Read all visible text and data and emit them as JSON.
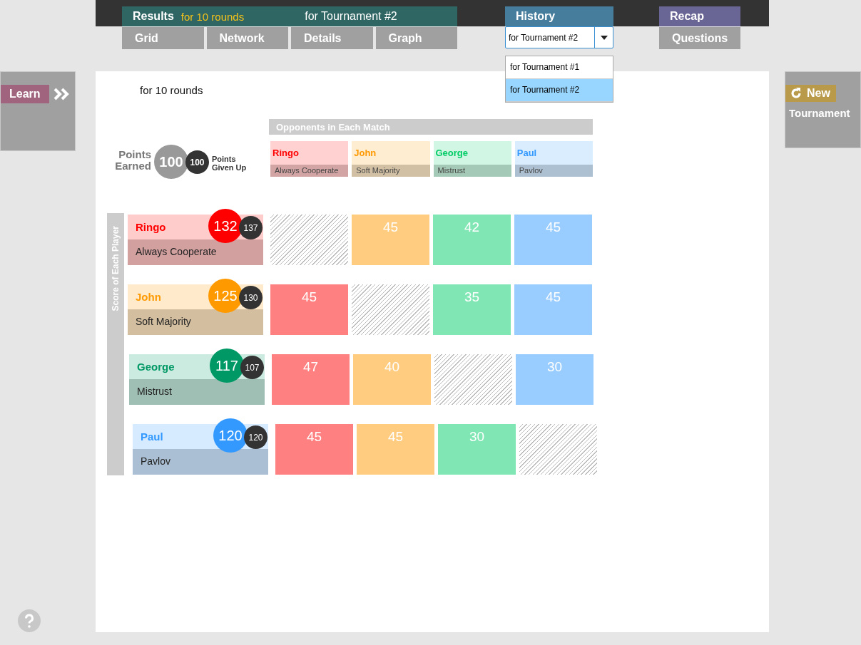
{
  "tab_groups": [
    {
      "label": "Results",
      "subtitle": "for 10 rounds",
      "caption": "for Tournament #2",
      "color": "#2f6663",
      "subtabs": [
        {
          "label": "Grid",
          "selected": false
        },
        {
          "label": "Network",
          "selected": false
        },
        {
          "label": "Details",
          "selected": false
        },
        {
          "label": "Graph",
          "selected": false
        }
      ]
    },
    {
      "label": "History",
      "color": "#467d9c",
      "dropdown": {
        "value": "for Tournament #2",
        "expanded": true,
        "options": [
          {
            "label": "for Tournament #1",
            "selected": false
          },
          {
            "label": "for Tournament #2",
            "selected": true
          }
        ]
      }
    },
    {
      "label": "Recap",
      "color": "#696594",
      "subtabs": [
        {
          "label": "Questions",
          "selected": false
        }
      ]
    }
  ],
  "learn_panel": {
    "label": "Learn"
  },
  "new_panel": {
    "label": "New",
    "sublabel": "Tournament"
  },
  "heading": "for 10 rounds",
  "legend": {
    "earned_label": "Points Earned",
    "earned_value": "100",
    "given_value": "100",
    "given_label": "Points Given Up"
  },
  "opponents_title": "Opponents in Each Match",
  "row_axis_title": "Score of Each Player",
  "opponents": [
    {
      "name": "Ringo",
      "strategy": "Always Cooperate",
      "color": "#ff0000"
    },
    {
      "name": "John",
      "strategy": "Soft Majority",
      "color": "#ff9900"
    },
    {
      "name": "George",
      "strategy": "Mistrust",
      "color": "#00cc66"
    },
    {
      "name": "Paul",
      "strategy": "Pavlov",
      "color": "#3399ff"
    }
  ],
  "players": [
    {
      "name": "Ringo",
      "strategy": "Always Cooperate",
      "color": "#ff0000",
      "score": "132",
      "given_up": "137",
      "cells": [
        {
          "kind": "self"
        },
        {
          "kind": "score",
          "value": "45"
        },
        {
          "kind": "score",
          "value": "42"
        },
        {
          "kind": "score",
          "value": "45"
        }
      ]
    },
    {
      "name": "John",
      "strategy": "Soft Majority",
      "color": "#ff9900",
      "score": "125",
      "given_up": "130",
      "cells": [
        {
          "kind": "score",
          "value": "45"
        },
        {
          "kind": "self"
        },
        {
          "kind": "score",
          "value": "35"
        },
        {
          "kind": "score",
          "value": "45"
        }
      ]
    },
    {
      "name": "George",
      "strategy": "Mistrust",
      "color": "#009966",
      "score": "117",
      "given_up": "107",
      "cells": [
        {
          "kind": "score",
          "value": "47"
        },
        {
          "kind": "score",
          "value": "40"
        },
        {
          "kind": "self"
        },
        {
          "kind": "score",
          "value": "30"
        }
      ]
    },
    {
      "name": "Paul",
      "strategy": "Pavlov",
      "color": "#3399ff",
      "score": "120",
      "given_up": "120",
      "cells": [
        {
          "kind": "score",
          "value": "45"
        },
        {
          "kind": "score",
          "value": "45"
        },
        {
          "kind": "score",
          "value": "30"
        },
        {
          "kind": "self"
        }
      ]
    }
  ]
}
